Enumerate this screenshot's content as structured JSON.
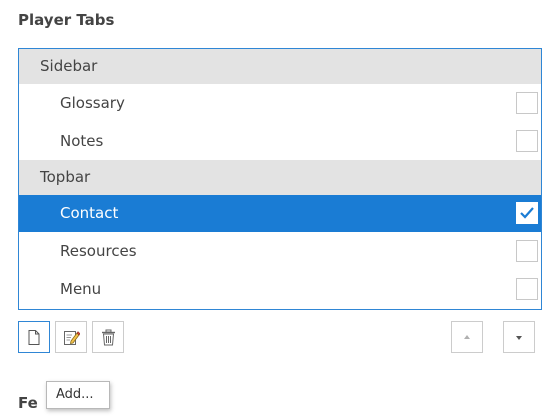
{
  "section_title": "Player Tabs",
  "groups": [
    {
      "label": "Sidebar",
      "items": [
        {
          "label": "Glossary",
          "checked": false,
          "selected": false
        },
        {
          "label": "Notes",
          "checked": false,
          "selected": false
        }
      ]
    },
    {
      "label": "Topbar",
      "items": [
        {
          "label": "Contact",
          "checked": true,
          "selected": true
        },
        {
          "label": "Resources",
          "checked": false,
          "selected": false
        },
        {
          "label": "Menu",
          "checked": false,
          "selected": false
        }
      ]
    }
  ],
  "toolbar": {
    "add_icon": "new-document-icon",
    "edit_icon": "edit-icon",
    "delete_icon": "trash-icon",
    "move_up_icon": "up-arrow-icon",
    "move_down_icon": "down-arrow-icon"
  },
  "tooltip": {
    "text": "Add..."
  },
  "next_section_title": "Fe",
  "colors": {
    "accent": "#1a7cd4",
    "border_accent": "#2f86d5",
    "group_background": "#e3e3e3"
  }
}
